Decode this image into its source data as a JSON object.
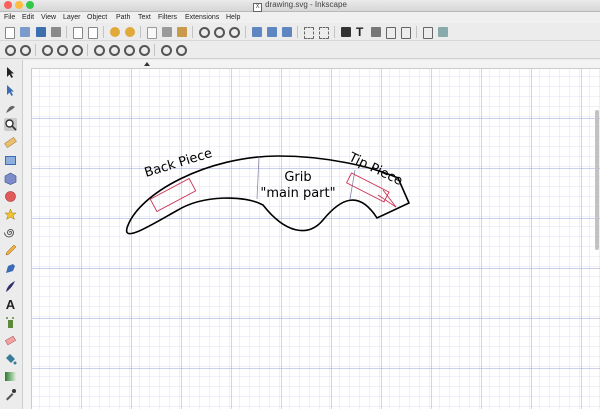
{
  "window": {
    "title": "drawing.svg - Inkscape"
  },
  "menu": [
    "File",
    "Edit",
    "View",
    "Layer",
    "Object",
    "Path",
    "Text",
    "Filters",
    "Extensions",
    "Help"
  ],
  "drawing": {
    "labels": {
      "back_piece": "Back Piece",
      "tip_piece": "Tip Piece",
      "grib": "Grib",
      "main_part": "\"main part\""
    }
  },
  "colors": {
    "outline": "#000000",
    "accent": "#cc3355",
    "grid": "#c8cce8",
    "grid_major": "#9aa0d8"
  }
}
